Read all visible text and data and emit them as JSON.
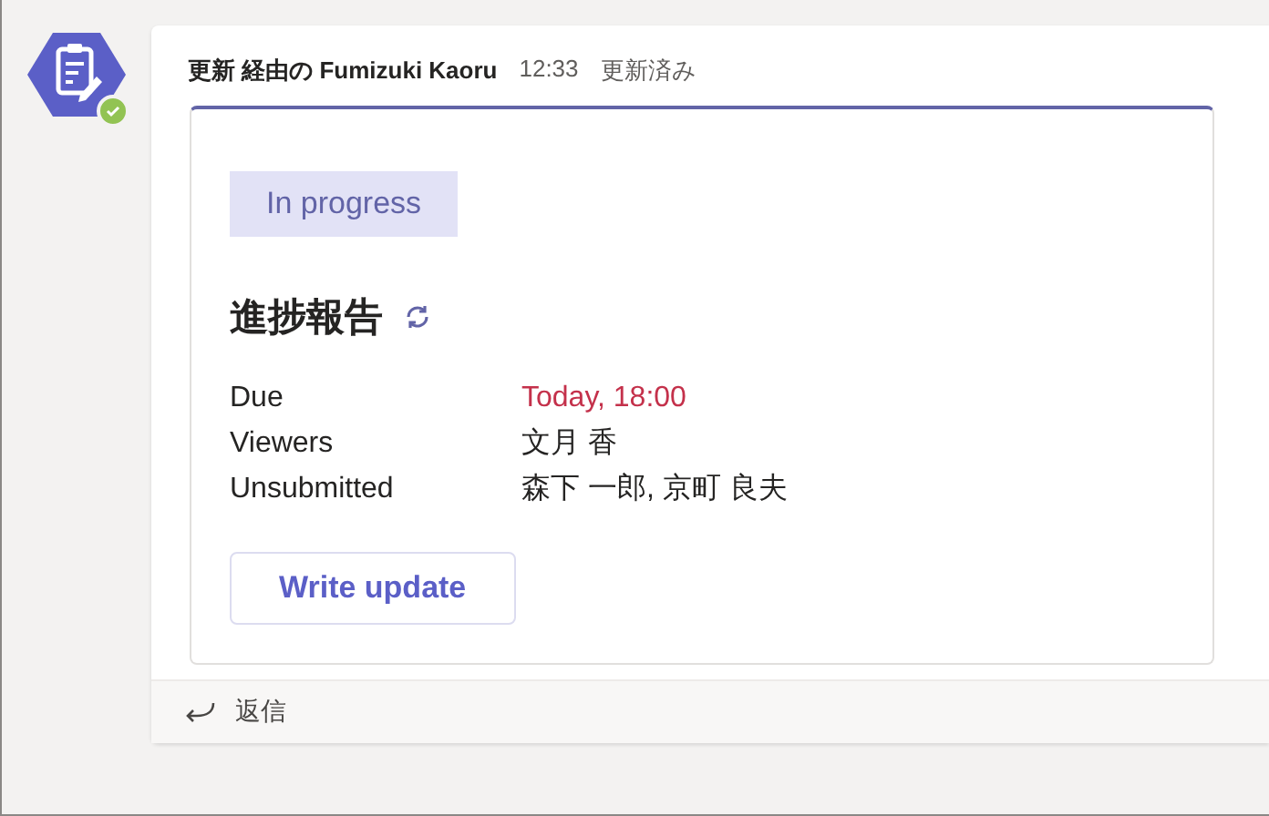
{
  "message": {
    "author": "更新 経由の Fumizuki Kaoru",
    "time": "12:33",
    "edited": "更新済み",
    "online": true
  },
  "card": {
    "status": "In progress",
    "title": "進捗報告",
    "fields": [
      {
        "label": "Due",
        "value": "Today, 18:00",
        "kind": "urgent"
      },
      {
        "label": "Viewers",
        "value": "文月 香",
        "kind": "plain"
      },
      {
        "label": "Unsubmitted",
        "value": "森下 一郎, 京町 良夫",
        "kind": "plain"
      }
    ],
    "action": "Write update"
  },
  "reply": {
    "label": "返信"
  }
}
